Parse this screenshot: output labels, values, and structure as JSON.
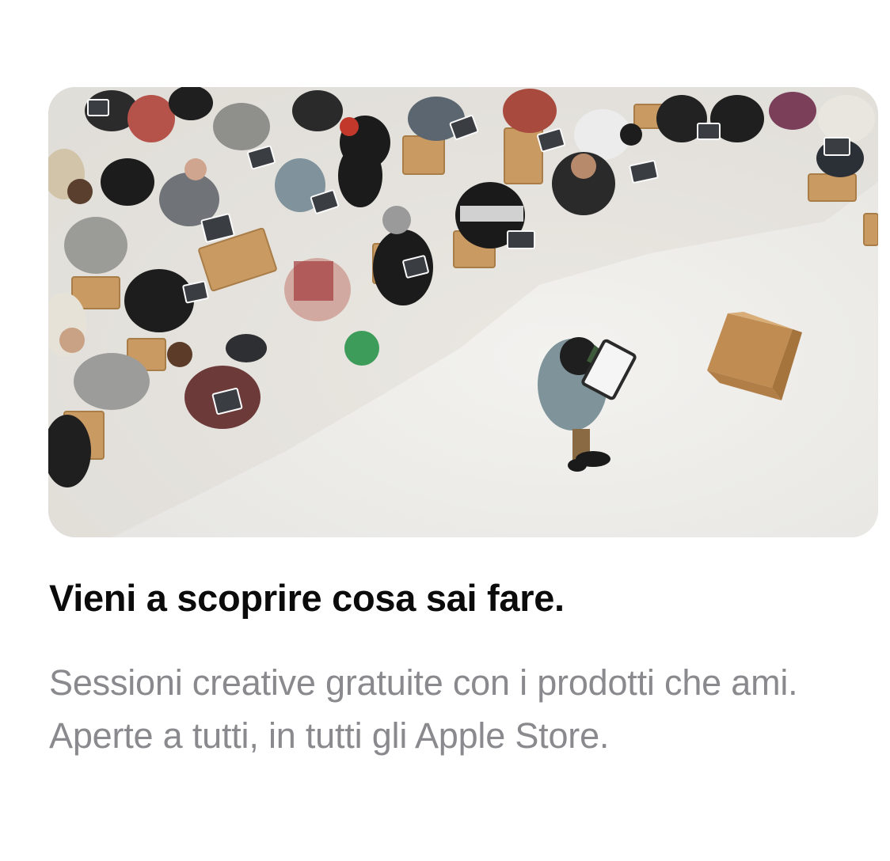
{
  "card": {
    "image_icon": "photo-session-crowd",
    "title": "Vieni a scoprire cosa sai fare.",
    "description": "Sessioni creative gratuite con i prodotti che ami. Aperte a tutti, in tutti gli Apple Store."
  },
  "colors": {
    "background": "#ffffff",
    "title": "#0b0b0b",
    "description": "#8a8a8e",
    "floor": "#ececea"
  }
}
